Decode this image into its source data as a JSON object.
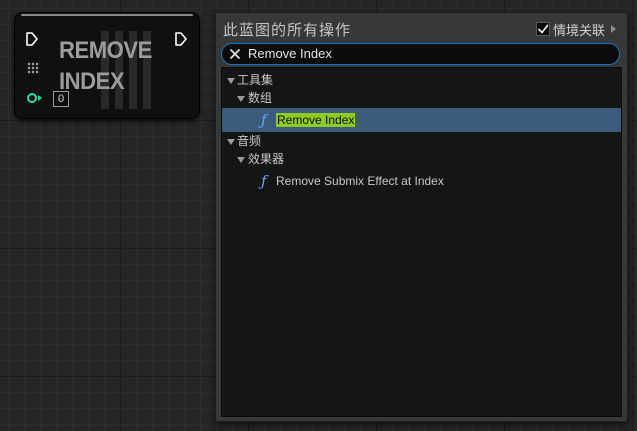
{
  "node": {
    "title_line1": "REMOVE",
    "title_line2": "INDEX",
    "index_value": "0",
    "pin_colors": {
      "exec": "#ffffff",
      "integer": "#1fe3a6"
    }
  },
  "menu": {
    "header": "此蓝图的所有操作",
    "context_sensitive_label": "情境关联",
    "context_sensitive_checked": true,
    "search_value": "Remove Index",
    "search_placeholder": "",
    "accent_color": "#1a73c8",
    "tree": [
      {
        "kind": "category",
        "label": "工具集",
        "depth": 0,
        "expanded": true
      },
      {
        "kind": "category",
        "label": "数组",
        "depth": 1,
        "expanded": true
      },
      {
        "kind": "function",
        "label": "Remove Index",
        "depth": 2,
        "selected": true,
        "highlight": "Remove Index"
      },
      {
        "kind": "category",
        "label": "音频",
        "depth": 0,
        "expanded": true
      },
      {
        "kind": "category",
        "label": "效果器",
        "depth": 1,
        "expanded": true
      },
      {
        "kind": "function",
        "label": "Remove Submix Effect at Index",
        "depth": 2,
        "selected": false
      }
    ],
    "highlight_color": "#8fcc22",
    "selection_color": "#3c5a7a",
    "function_icon_color": "#5fa8ff"
  }
}
